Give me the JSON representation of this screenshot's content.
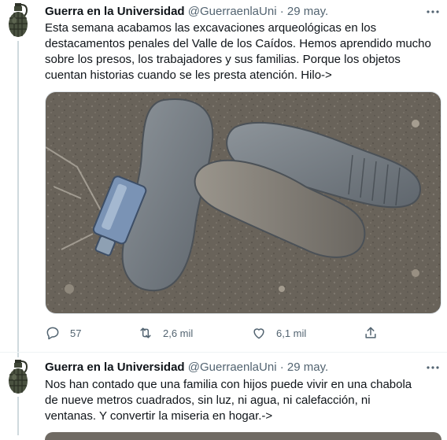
{
  "tweets": [
    {
      "name": "Guerra en la Universidad",
      "handle": "@GuerraenlaUni",
      "separator": "·",
      "time": "29 may.",
      "text": "Esta semana acabamos las excavaciones arqueológicas en los destacamentos penales del Valle de los Caídos. Hemos aprendido mucho sobre los presos, los trabajadores y sus familias. Porque los objetos cuentan historias cuando se les presta atención. Hilo->",
      "replies": "57",
      "retweets": "2,6 mil",
      "likes": "6,1 mil"
    },
    {
      "name": "Guerra en la Universidad",
      "handle": "@GuerraenlaUni",
      "separator": "·",
      "time": "29 may.",
      "text": "Nos han contado que una familia con hijos puede vivir en una chabola de nueve metros cuadrados, sin luz, ni agua, ni calefacción, ni ventanas. Y convertir la miseria en hogar.->"
    }
  ],
  "icons": {
    "avatar": "grenade-icon",
    "more": "more-horizontal-icon",
    "reply": "reply-icon",
    "retweet": "retweet-icon",
    "like": "heart-icon",
    "share": "share-icon"
  },
  "colors": {
    "text": "#0f1419",
    "muted": "#536471",
    "divider": "#eff3f4"
  }
}
